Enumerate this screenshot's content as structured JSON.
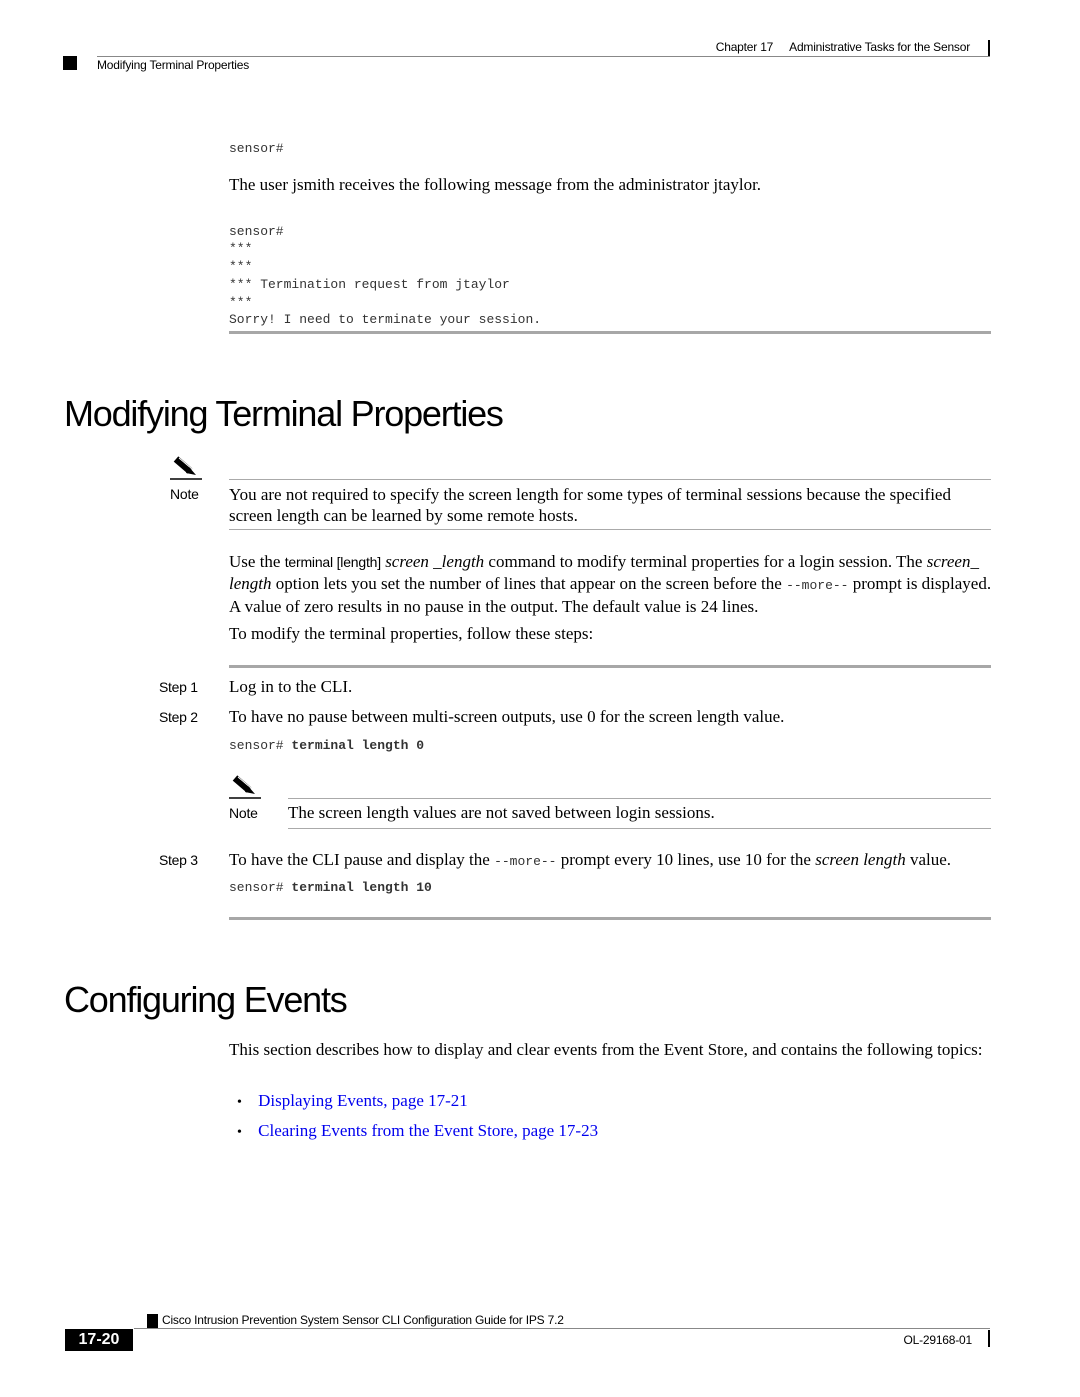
{
  "header": {
    "chapter": "Chapter 17",
    "chapter_title": "Administrative Tasks for the Sensor",
    "section": "Modifying Terminal Properties"
  },
  "intro": {
    "code1": "sensor#",
    "paragraph": "The user jsmith receives the following message from the administrator jtaylor.",
    "code2_lines": [
      "sensor#",
      "***",
      "***",
      "*** Termination request from jtaylor",
      "***",
      "Sorry! I need to terminate your session."
    ]
  },
  "section1": {
    "title": "Modifying Terminal Properties",
    "note1": {
      "label": "Note",
      "text": "You are not required to specify the screen length for some types of terminal sessions because the specified screen length can be learned by some remote hosts."
    },
    "para1": {
      "t1": "Use the ",
      "cmd": "terminal [length]",
      "t2": " ",
      "arg": "screen _length",
      "t3": " command to modify terminal properties for a login session. The ",
      "arg2": "screen_ length",
      "t4": " option lets you set the number of lines that appear on the screen before the ",
      "more": "--more--",
      "t5": " prompt is displayed. A value of zero results in no pause in the output. The default value is 24 lines."
    },
    "para2": "To modify the terminal properties, follow these steps:",
    "steps": [
      {
        "label": "Step 1",
        "text": "Log in to the CLI."
      },
      {
        "label": "Step 2",
        "text": "To have no pause between multi-screen outputs, use 0 for the screen length value.",
        "prompt": "sensor# ",
        "command": "terminal length 0"
      },
      {
        "label": "Step 3",
        "t1": "To have the CLI pause and display the ",
        "more": "--more--",
        "t2": " prompt every 10 lines, use 10 for the ",
        "arg": "screen length",
        "t3": " value.",
        "prompt": "sensor# ",
        "command": "terminal length 10"
      }
    ],
    "note2": {
      "label": "Note",
      "text": "The screen length values are not saved between login sessions."
    }
  },
  "section2": {
    "title": "Configuring Events",
    "paragraph": "This section describes how to display and clear events from the Event Store, and contains the following topics:",
    "links": [
      {
        "bullet": "•",
        "text": "Displaying Events, page 17-21"
      },
      {
        "bullet": "•",
        "text": "Clearing Events from the Event Store, page 17-23"
      }
    ],
    "link_color": "#0000ee"
  },
  "footer": {
    "guide_title": "Cisco Intrusion Prevention System Sensor CLI Configuration Guide for IPS 7.2",
    "page_number": "17-20",
    "doc_id": "OL-29168-01"
  }
}
